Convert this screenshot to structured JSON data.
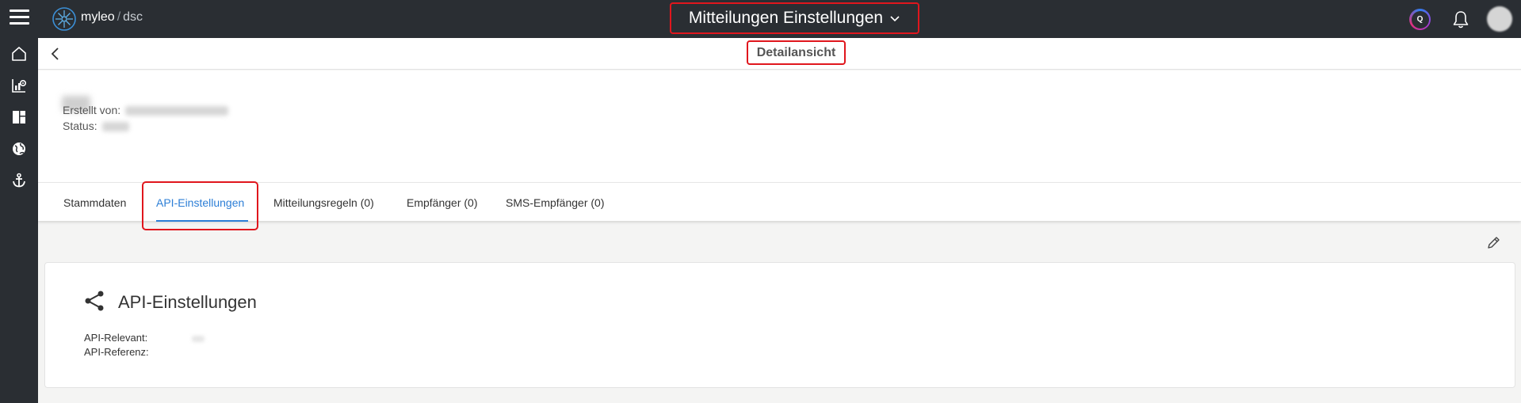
{
  "app": {
    "brand": "myleo",
    "brand_separator": "/",
    "brand_sub": "dsc",
    "title": "Mitteilungen Einstellungen"
  },
  "header": {
    "q_button_label": "Q"
  },
  "detail": {
    "title": "Detailansicht"
  },
  "info": {
    "created_by_label": "Erstellt von:",
    "status_label": "Status:"
  },
  "tabs": [
    {
      "label": "Stammdaten",
      "active": false
    },
    {
      "label": "API-Einstellungen",
      "active": true
    },
    {
      "label": "Mitteilungsregeln (0)",
      "active": false
    },
    {
      "label": "Empfänger (0)",
      "active": false
    },
    {
      "label": "SMS-Empfänger (0)",
      "active": false
    }
  ],
  "card": {
    "title": "API-Einstellungen",
    "api_relevant_label": "API-Relevant:",
    "api_reference_label": "API-Referenz:"
  },
  "icons": {
    "menu": "hamburger-icon",
    "logo": "myleo-logo-icon",
    "title_dropdown": "chevron-down-icon",
    "notifications": "bell-icon",
    "rail": [
      "home-icon",
      "chart-settings-icon",
      "dashboard-icon",
      "globe-icon",
      "anchor-icon"
    ],
    "back": "chevron-left-icon",
    "edit": "pencil-icon",
    "card": "share-icon"
  },
  "colors": {
    "topbar_bg": "#2a2e33",
    "accent_blue": "#2c7ed6",
    "highlight_red": "#e0161d",
    "page_bg": "#f4f4f3"
  }
}
